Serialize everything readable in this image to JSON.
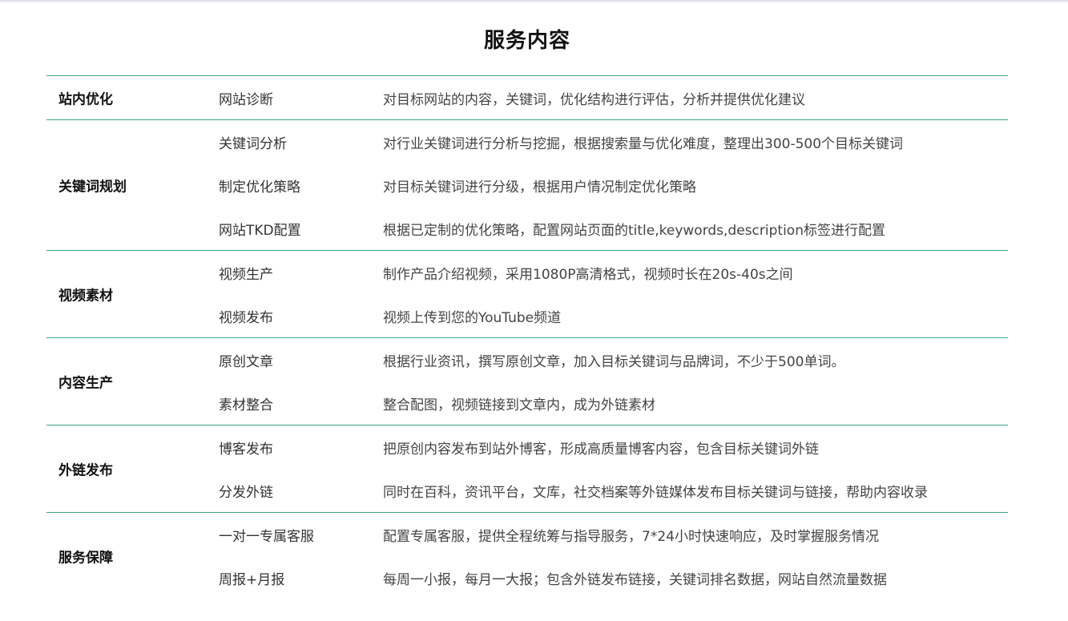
{
  "title": "服务内容",
  "groups": [
    {
      "category": "站内优化",
      "rows": [
        {
          "item": "网站诊断",
          "desc": "对目标网站的内容，关键词，优化结构进行评估，分析并提供优化建议"
        }
      ]
    },
    {
      "category": "关键词规划",
      "rows": [
        {
          "item": "关键词分析",
          "desc": "对行业关键词进行分析与挖掘，根据搜索量与优化难度，整理出300-500个目标关键词"
        },
        {
          "item": "制定优化策略",
          "desc": "对目标关键词进行分级，根据用户情况制定优化策略"
        },
        {
          "item": "网站TKD配置",
          "desc": "根据已定制的优化策略，配置网站页面的title,keywords,description标签进行配置"
        }
      ]
    },
    {
      "category": "视频素材",
      "rows": [
        {
          "item": "视频生产",
          "desc": "制作产品介绍视频，采用1080P高清格式，视频时长在20s-40s之间"
        },
        {
          "item": "视频发布",
          "desc": "视频上传到您的YouTube频道"
        }
      ]
    },
    {
      "category": "内容生产",
      "rows": [
        {
          "item": "原创文章",
          "desc": "根据行业资讯，撰写原创文章，加入目标关键词与品牌词，不少于500单词。"
        },
        {
          "item": "素材整合",
          "desc": "整合配图，视频链接到文章内，成为外链素材"
        }
      ]
    },
    {
      "category": "外链发布",
      "rows": [
        {
          "item": "博客发布",
          "desc": "把原创内容发布到站外博客，形成高质量博客内容，包含目标关键词外链"
        },
        {
          "item": "分发外链",
          "desc": "同时在百科，资讯平台，文库，社交档案等外链媒体发布目标关键词与链接，帮助内容收录"
        }
      ]
    },
    {
      "category": "服务保障",
      "rows": [
        {
          "item": "一对一专属客服",
          "desc": "配置专属客服，提供全程统筹与指导服务，7*24小时快速响应，及时掌握服务情况"
        },
        {
          "item": "周报+月报",
          "desc": "每周一小报，每月一大报；包含外链发布链接，关键词排名数据，网站自然流量数据"
        }
      ]
    }
  ],
  "colors": {
    "divider": "#3aa58a",
    "heading": "#111111",
    "text": "#333333"
  }
}
